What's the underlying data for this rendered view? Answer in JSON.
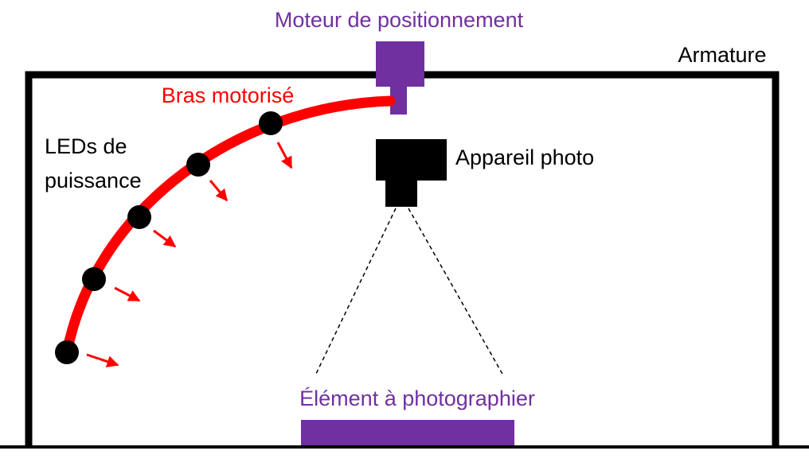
{
  "labels": {
    "motor": "Moteur de positionnement",
    "frame": "Armature",
    "arm": "Bras motorisé",
    "leds_line1": "LEDs de",
    "leds_line2": "puissance",
    "camera": "Appareil photo",
    "subject": "Élément à photographier"
  },
  "colors": {
    "purple": "#7030a0",
    "red": "#ff0000",
    "black": "#000000"
  },
  "led_count": 5
}
